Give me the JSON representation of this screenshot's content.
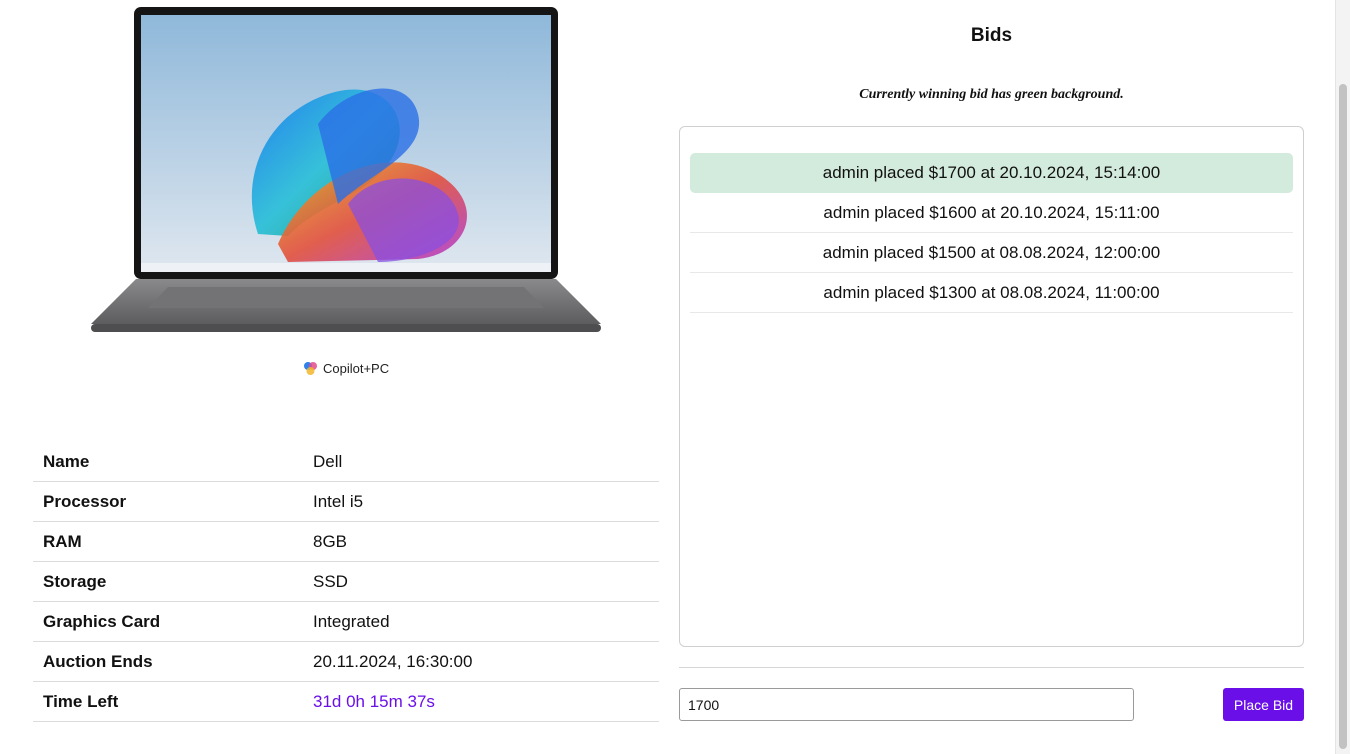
{
  "product": {
    "image_alt": "Dell laptop",
    "badge_text": "Copilot+PC"
  },
  "specs": [
    {
      "label": "Name",
      "value": "Dell"
    },
    {
      "label": "Processor",
      "value": "Intel i5"
    },
    {
      "label": "RAM",
      "value": "8GB"
    },
    {
      "label": "Storage",
      "value": "SSD"
    },
    {
      "label": "Graphics Card",
      "value": "Integrated"
    },
    {
      "label": "Auction Ends",
      "value": "20.11.2024, 16:30:00"
    },
    {
      "label": "Time Left",
      "value": "31d 0h 15m 37s"
    }
  ],
  "bids": {
    "title": "Bids",
    "note": "Currently winning bid has green background.",
    "items": [
      {
        "text": "admin placed $1700 at 20.10.2024, 15:14:00",
        "winning": true
      },
      {
        "text": "admin placed $1600 at 20.10.2024, 15:11:00",
        "winning": false
      },
      {
        "text": "admin placed $1500 at 08.08.2024, 12:00:00",
        "winning": false
      },
      {
        "text": "admin placed $1300 at 08.08.2024, 11:00:00",
        "winning": false
      }
    ],
    "input_value": "1700",
    "button_label": "Place Bid"
  },
  "colors": {
    "accent": "#6a0fe8",
    "winning_bg": "#d3ebdc"
  },
  "icons": {
    "badge_icon": "copilot-logo-icon"
  }
}
